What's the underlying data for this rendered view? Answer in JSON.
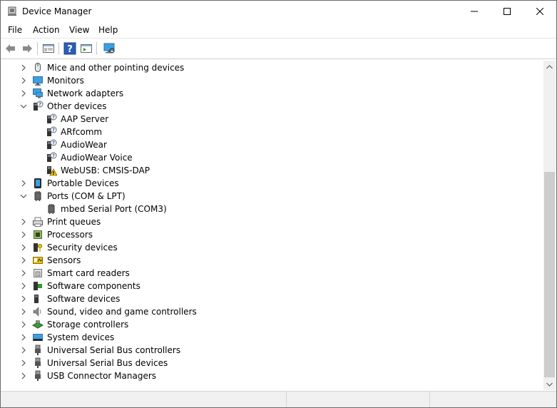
{
  "window": {
    "title": "Device Manager"
  },
  "menu": [
    "File",
    "Action",
    "View",
    "Help"
  ],
  "toolbar": {
    "buttons": [
      "back-arrow-icon",
      "forward-arrow-icon",
      "properties-icon",
      "help-icon",
      "run-icon",
      "monitor-scan-icon"
    ]
  },
  "tree": [
    {
      "label": "Mice and other pointing devices",
      "icon": "mouse-icon",
      "expanded": false,
      "level": 0
    },
    {
      "label": "Monitors",
      "icon": "monitor-icon",
      "expanded": false,
      "level": 0
    },
    {
      "label": "Network adapters",
      "icon": "network-icon",
      "expanded": false,
      "level": 0
    },
    {
      "label": "Other devices",
      "icon": "unknown-device-icon",
      "expanded": true,
      "level": 0
    },
    {
      "label": "AAP Server",
      "icon": "unknown-device-icon",
      "level": 1
    },
    {
      "label": "ARfcomm",
      "icon": "unknown-device-icon",
      "level": 1
    },
    {
      "label": "AudioWear",
      "icon": "unknown-device-icon",
      "level": 1
    },
    {
      "label": "AudioWear Voice",
      "icon": "unknown-device-icon",
      "level": 1
    },
    {
      "label": "WebUSB: CMSIS-DAP",
      "icon": "warning-device-icon",
      "level": 1
    },
    {
      "label": "Portable Devices",
      "icon": "portable-device-icon",
      "expanded": false,
      "level": 0
    },
    {
      "label": "Ports (COM & LPT)",
      "icon": "port-icon",
      "expanded": true,
      "level": 0
    },
    {
      "label": "mbed Serial Port (COM3)",
      "icon": "port-icon",
      "level": 1
    },
    {
      "label": "Print queues",
      "icon": "printer-icon",
      "expanded": false,
      "level": 0
    },
    {
      "label": "Processors",
      "icon": "processor-icon",
      "expanded": false,
      "level": 0
    },
    {
      "label": "Security devices",
      "icon": "security-key-icon",
      "expanded": false,
      "level": 0
    },
    {
      "label": "Sensors",
      "icon": "sensor-icon",
      "expanded": false,
      "level": 0
    },
    {
      "label": "Smart card readers",
      "icon": "smart-card-icon",
      "expanded": false,
      "level": 0
    },
    {
      "label": "Software components",
      "icon": "software-component-icon",
      "expanded": false,
      "level": 0
    },
    {
      "label": "Software devices",
      "icon": "software-device-icon",
      "expanded": false,
      "level": 0
    },
    {
      "label": "Sound, video and game controllers",
      "icon": "speaker-icon",
      "expanded": false,
      "level": 0
    },
    {
      "label": "Storage controllers",
      "icon": "storage-icon",
      "expanded": false,
      "level": 0
    },
    {
      "label": "System devices",
      "icon": "system-device-icon",
      "expanded": false,
      "level": 0
    },
    {
      "label": "Universal Serial Bus controllers",
      "icon": "usb-icon",
      "expanded": false,
      "level": 0
    },
    {
      "label": "Universal Serial Bus devices",
      "icon": "usb-icon",
      "expanded": false,
      "level": 0
    },
    {
      "label": "USB Connector Managers",
      "icon": "usb-icon",
      "expanded": false,
      "level": 0
    }
  ],
  "colors": {
    "accent": "#1e7fd8",
    "warning": "#f2c200",
    "window_border": "#6b6b6b"
  }
}
